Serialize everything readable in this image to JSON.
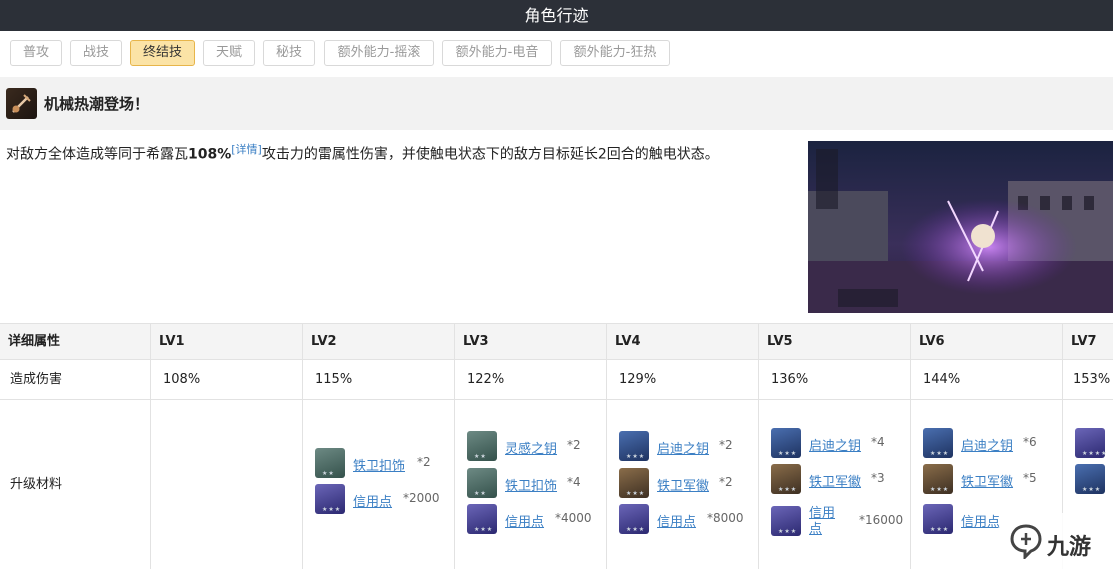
{
  "header": {
    "title": "角色行迹"
  },
  "tabs": [
    {
      "label": "普攻",
      "active": false
    },
    {
      "label": "战技",
      "active": false
    },
    {
      "label": "终结技",
      "active": true
    },
    {
      "label": "天赋",
      "active": false
    },
    {
      "label": "秘技",
      "active": false
    },
    {
      "label": "额外能力-摇滚",
      "active": false
    },
    {
      "label": "额外能力-电音",
      "active": false
    },
    {
      "label": "额外能力-狂热",
      "active": false
    }
  ],
  "skill": {
    "name": "机械热潮登场！",
    "desc_before": "对敌方全体造成等同于希露瓦",
    "desc_value": "108%",
    "desc_link": "[详情]",
    "desc_after": "攻击力的雷属性伤害，并使触电状态下的敌方目标延长2回合的触电状态。"
  },
  "table": {
    "header_label": "详细属性",
    "levels": [
      "LV1",
      "LV2",
      "LV3",
      "LV4",
      "LV5",
      "LV6",
      "LV7"
    ],
    "damage_label": "造成伤害",
    "damage": [
      "108%",
      "115%",
      "122%",
      "129%",
      "136%",
      "144%",
      "153%"
    ],
    "material_label": "升级材料",
    "materials": [
      [],
      [
        {
          "name": "铁卫扣饰",
          "qty": "*2",
          "color": "green"
        },
        {
          "name": "信用点",
          "qty": "*2000",
          "color": "purple"
        }
      ],
      [
        {
          "name": "灵感之钥",
          "qty": "*2",
          "color": "green"
        },
        {
          "name": "铁卫扣饰",
          "qty": "*4",
          "color": "green"
        },
        {
          "name": "信用点",
          "qty": "*4000",
          "color": "purple"
        }
      ],
      [
        {
          "name": "启迪之钥",
          "qty": "*2",
          "color": "blue"
        },
        {
          "name": "铁卫军徽",
          "qty": "*2",
          "color": "bronze"
        },
        {
          "name": "信用点",
          "qty": "*8000",
          "color": "purple"
        }
      ],
      [
        {
          "name": "启迪之钥",
          "qty": "*4",
          "color": "blue"
        },
        {
          "name": "铁卫军徽",
          "qty": "*3",
          "color": "bronze"
        },
        {
          "name": "信用点",
          "qty": "*16000",
          "color": "purple"
        }
      ],
      [
        {
          "name": "启迪之钥",
          "qty": "*6",
          "color": "blue"
        },
        {
          "name": "铁卫军徽",
          "qty": "*5",
          "color": "bronze"
        },
        {
          "name": "信用点",
          "qty": "",
          "color": "purple"
        }
      ],
      []
    ]
  },
  "watermark": {
    "text": "九游"
  }
}
